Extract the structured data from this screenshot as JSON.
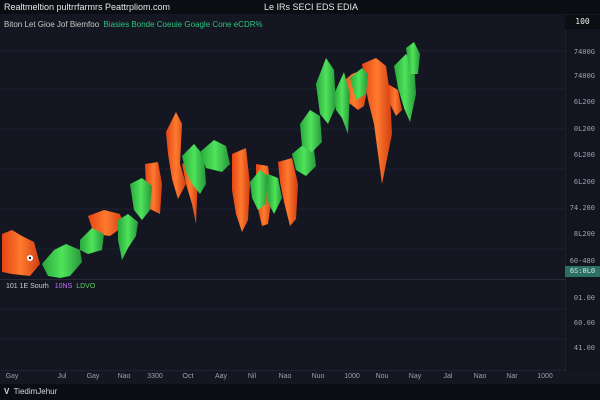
{
  "window": {
    "app_title": "Realtmeltion  pultrrfarmrs Peattrpliom.com",
    "title": "Le IRs SECI  EDS  EDIA"
  },
  "legend": {
    "symbol": "Biton  Let  Gioe  Jof  Biemfoo",
    "ohlc": "Biasies  Bonde  Coeuie  Goagle  Cone  eCDR%"
  },
  "price_axis": {
    "current": "100",
    "ticks": [
      "7400G",
      "7400G",
      "6L200",
      "0L200",
      "6L200",
      "6L200",
      "74.200",
      "8L200",
      "60-480"
    ],
    "pane_label": "6S:0L0",
    "lower_ticks": [
      "01.00",
      "60.00",
      "41.00"
    ]
  },
  "indicator": {
    "name": "101 1E Sourh",
    "value_a": "10NS",
    "value_b": "LDVO"
  },
  "time_axis": {
    "labels": [
      "Gay",
      "Jul",
      "Gay",
      "Nao",
      "3300",
      "Oct",
      "Aay",
      "Nil",
      "Nao",
      "Nuo",
      "1000",
      "Nou",
      "Nay",
      "Jal",
      "Nao",
      "Nar",
      "1000"
    ]
  },
  "footer": {
    "logo": "V",
    "brand": "TiedimJehur"
  },
  "colors": {
    "up": "#33c44a",
    "down": "#ff5a21",
    "background": "#141722"
  }
}
